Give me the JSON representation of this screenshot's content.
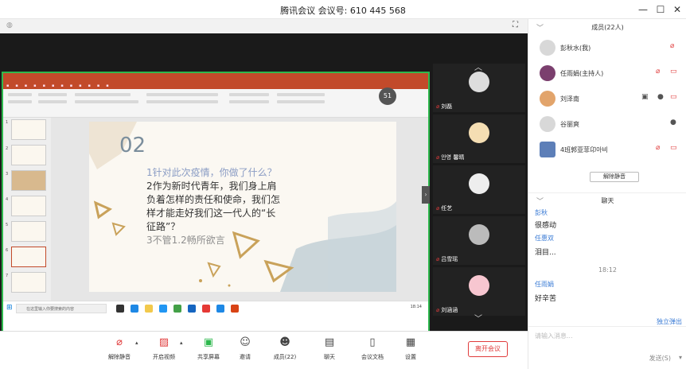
{
  "window": {
    "title": "腾讯会议 会议号: 610 445 568",
    "controls": {
      "minimize": "—",
      "maximize": "☐",
      "close": "✕"
    }
  },
  "share": {
    "slide": {
      "number": "02",
      "lines": [
        "1针对此次疫情，你做了什么？",
        "2作为新时代青年，我们身上肩",
        "负着怎样的责任和使命，我们怎",
        "样才能走好我们这一代人的“长",
        "征路”？",
        "3不管1.2畅所欲言"
      ]
    },
    "meeting_badge": "51",
    "taskbar_search": "在这里输入你要搜索的内容",
    "tray_time": "18:14"
  },
  "videos": [
    {
      "name": "刘磊"
    },
    {
      "name": "안영 馨晴"
    },
    {
      "name": "任艺"
    },
    {
      "name": "吕雪瑶"
    },
    {
      "name": "刘涵涵"
    }
  ],
  "members": {
    "header": "成员(22人)",
    "list": [
      {
        "name": "彭秋水(我)"
      },
      {
        "name": "任雨娟(主持人)"
      },
      {
        "name": "刘泽南"
      },
      {
        "name": "谷丽爽"
      },
      {
        "name": "4班郭亚菲卬아비"
      }
    ],
    "unmute_all": "解除静音"
  },
  "chat": {
    "header": "聊天",
    "messages": [
      {
        "name": "彭秋",
        "text": "很感动"
      },
      {
        "name": "任惠双",
        "text": "泪目..."
      }
    ],
    "time": "18:12",
    "last": {
      "name": "任雨娟",
      "text": "好辛苦"
    },
    "popout": "独立弹出",
    "placeholder": "请输入消息...",
    "send": "发送(S)"
  },
  "toolbar": {
    "mute": "解除静音",
    "video": "开启视频",
    "share": "共享屏幕",
    "invite": "邀请",
    "members": "成员(22)",
    "chat": "聊天",
    "docs": "会议文档",
    "settings": "设置",
    "end": "离开会议"
  },
  "colors": {
    "accent_green": "#2db84d",
    "ppt_red": "#c24a2a",
    "danger": "#e03c3c",
    "link_blue": "#3a7bd5"
  }
}
